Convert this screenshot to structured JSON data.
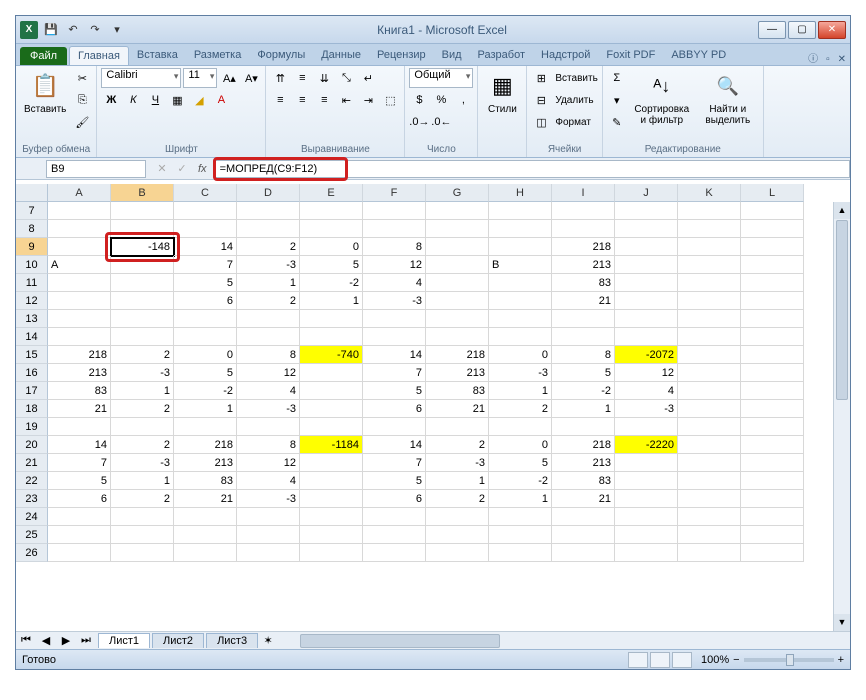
{
  "window": {
    "title": "Книга1 - Microsoft Excel"
  },
  "tabs": {
    "file": "Файл",
    "items": [
      "Главная",
      "Вставка",
      "Разметка",
      "Формулы",
      "Данные",
      "Рецензир",
      "Вид",
      "Разработ",
      "Надстрой",
      "Foxit PDF",
      "ABBYY PD"
    ],
    "active": 0
  },
  "ribbon": {
    "clipboard": {
      "paste": "Вставить",
      "label": "Буфер обмена"
    },
    "font": {
      "name": "Calibri",
      "size": "11",
      "label": "Шрифт"
    },
    "align": {
      "label": "Выравнивание"
    },
    "number": {
      "format": "Общий",
      "label": "Число"
    },
    "styles": {
      "btn": "Стили"
    },
    "cells": {
      "insert": "Вставить",
      "delete": "Удалить",
      "format": "Формат",
      "label": "Ячейки"
    },
    "editing": {
      "sort": "Сортировка и фильтр",
      "find": "Найти и выделить",
      "label": "Редактирование"
    }
  },
  "namebox": "B9",
  "formula": "=МОПРЕД(C9:F12)",
  "columns": [
    "A",
    "B",
    "C",
    "D",
    "E",
    "F",
    "G",
    "H",
    "I",
    "J",
    "K",
    "L"
  ],
  "active_col": "B",
  "active_row": 9,
  "rows": [
    {
      "n": 7,
      "cells": [
        "",
        "",
        "",
        "",
        "",
        "",
        "",
        "",
        "",
        "",
        "",
        ""
      ]
    },
    {
      "n": 8,
      "cells": [
        "",
        "",
        "",
        "",
        "",
        "",
        "",
        "",
        "",
        "",
        "",
        ""
      ]
    },
    {
      "n": 9,
      "cells": [
        "",
        "-148",
        "14",
        "2",
        "0",
        "8",
        "",
        "",
        "218",
        "",
        "",
        ""
      ],
      "sel": 1
    },
    {
      "n": 10,
      "cells": [
        "A",
        "",
        "7",
        "-3",
        "5",
        "12",
        "",
        "B",
        "213",
        "",
        "",
        ""
      ],
      "left": [
        0,
        7
      ]
    },
    {
      "n": 11,
      "cells": [
        "",
        "",
        "5",
        "1",
        "-2",
        "4",
        "",
        "",
        "83",
        "",
        "",
        ""
      ]
    },
    {
      "n": 12,
      "cells": [
        "",
        "",
        "6",
        "2",
        "1",
        "-3",
        "",
        "",
        "21",
        "",
        "",
        ""
      ]
    },
    {
      "n": 13,
      "cells": [
        "",
        "",
        "",
        "",
        "",
        "",
        "",
        "",
        "",
        "",
        "",
        ""
      ]
    },
    {
      "n": 14,
      "cells": [
        "",
        "",
        "",
        "",
        "",
        "",
        "",
        "",
        "",
        "",
        "",
        ""
      ]
    },
    {
      "n": 15,
      "cells": [
        "218",
        "2",
        "0",
        "8",
        "-740",
        "14",
        "218",
        "0",
        "8",
        "-2072",
        "",
        ""
      ],
      "yellow": [
        4,
        9
      ]
    },
    {
      "n": 16,
      "cells": [
        "213",
        "-3",
        "5",
        "12",
        "",
        "7",
        "213",
        "-3",
        "5",
        "12",
        "",
        ""
      ]
    },
    {
      "n": 17,
      "cells": [
        "83",
        "1",
        "-2",
        "4",
        "",
        "5",
        "83",
        "1",
        "-2",
        "4",
        "",
        ""
      ]
    },
    {
      "n": 18,
      "cells": [
        "21",
        "2",
        "1",
        "-3",
        "",
        "6",
        "21",
        "2",
        "1",
        "-3",
        "",
        ""
      ]
    },
    {
      "n": 19,
      "cells": [
        "",
        "",
        "",
        "",
        "",
        "",
        "",
        "",
        "",
        "",
        "",
        ""
      ]
    },
    {
      "n": 20,
      "cells": [
        "14",
        "2",
        "218",
        "8",
        "-1184",
        "14",
        "2",
        "0",
        "218",
        "-2220",
        "",
        ""
      ],
      "yellow": [
        4,
        9
      ]
    },
    {
      "n": 21,
      "cells": [
        "7",
        "-3",
        "213",
        "12",
        "",
        "7",
        "-3",
        "5",
        "213",
        "",
        "",
        ""
      ]
    },
    {
      "n": 22,
      "cells": [
        "5",
        "1",
        "83",
        "4",
        "",
        "5",
        "1",
        "-2",
        "83",
        "",
        "",
        ""
      ]
    },
    {
      "n": 23,
      "cells": [
        "6",
        "2",
        "21",
        "-3",
        "",
        "6",
        "2",
        "1",
        "21",
        "",
        "",
        ""
      ]
    },
    {
      "n": 24,
      "cells": [
        "",
        "",
        "",
        "",
        "",
        "",
        "",
        "",
        "",
        "",
        "",
        ""
      ]
    },
    {
      "n": 25,
      "cells": [
        "",
        "",
        "",
        "",
        "",
        "",
        "",
        "",
        "",
        "",
        "",
        ""
      ]
    },
    {
      "n": 26,
      "cells": [
        "",
        "",
        "",
        "",
        "",
        "",
        "",
        "",
        "",
        "",
        "",
        ""
      ]
    }
  ],
  "sheets": [
    "Лист1",
    "Лист2",
    "Лист3"
  ],
  "status": "Готово",
  "zoom": "100%"
}
